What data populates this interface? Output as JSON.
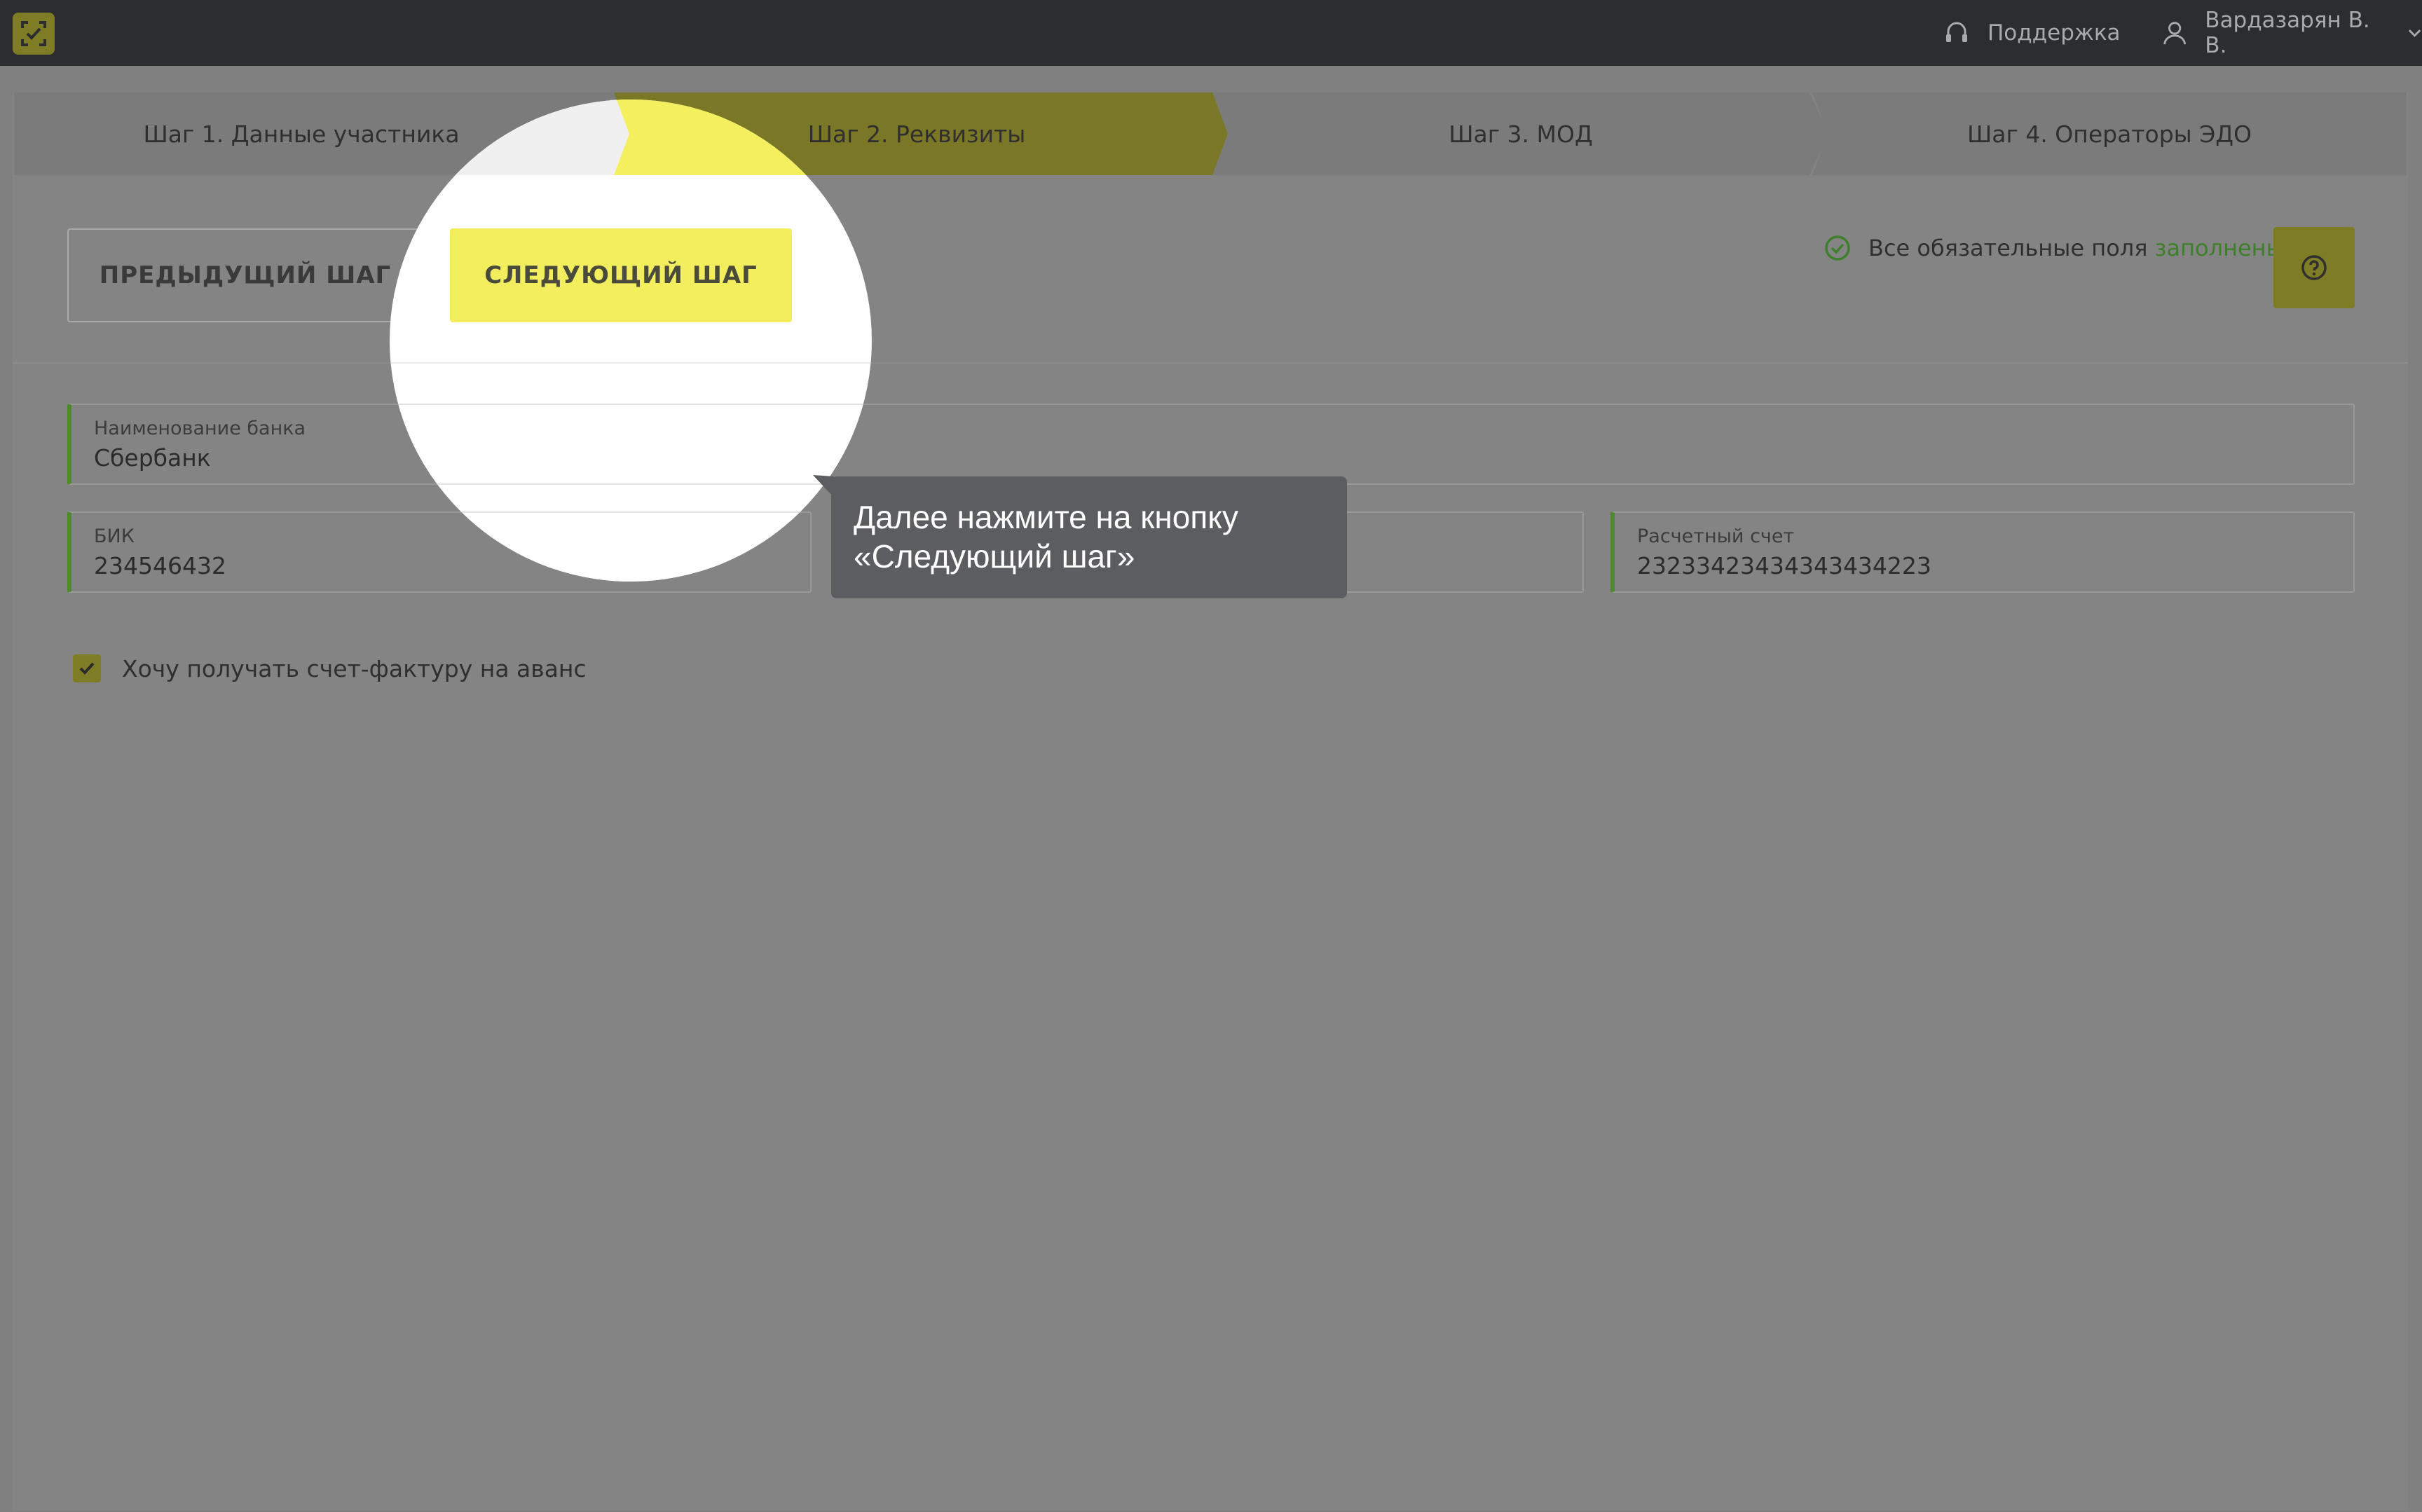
{
  "topbar": {
    "logo_icon": "logo-icon",
    "support_label": "Поддержка",
    "user_name": "Вардазарян В. В."
  },
  "steps": [
    {
      "label": "Шаг 1. Данные участника",
      "state": "done"
    },
    {
      "label": "Шаг 2. Реквизиты",
      "state": "active"
    },
    {
      "label": "Шаг 3. МОД",
      "state": "pending"
    },
    {
      "label": "Шаг 4. Операторы ЭДО",
      "state": "pending"
    }
  ],
  "toolbar": {
    "prev_label": "ПРЕДЫДУЩИЙ ШАГ",
    "next_label": "СЛЕДУЮЩИЙ ШАГ",
    "status_text": "Все обязательные поля",
    "status_ok": "заполнены"
  },
  "form": {
    "bank_name": {
      "label": "Наименование банка",
      "value": "Сбербанк"
    },
    "bik": {
      "label": "БИК",
      "value": "234546432"
    },
    "account": {
      "label": "Расчетный счет",
      "value": "23233423434343434223"
    },
    "invoice_checkbox": {
      "label": "Хочу получать счет-фактуру на аванс",
      "checked": true
    }
  },
  "tooltip": {
    "line1": "Далее нажмите на кнопку",
    "line2": "«Следующий шаг»"
  },
  "colors": {
    "accent_yellow": "#f2ee5e",
    "ok_green": "#3e7f2c",
    "topbar": "#2b2d30",
    "overlay": "#808080"
  }
}
